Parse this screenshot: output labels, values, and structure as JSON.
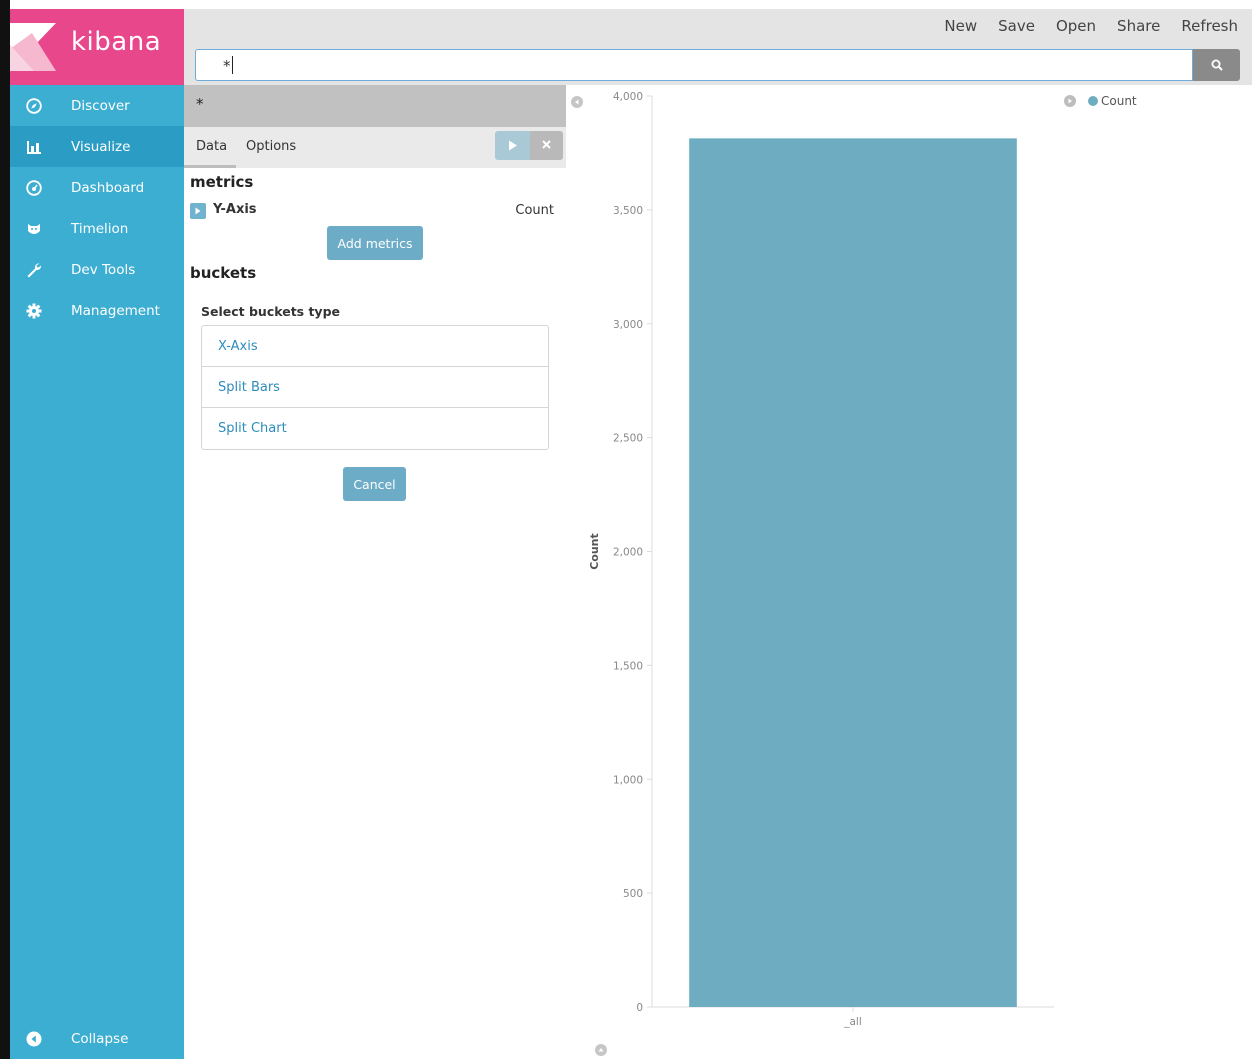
{
  "app": {
    "logo_text": "kibana",
    "brand_color": "#e8488b",
    "sidebar_color": "#3caed2"
  },
  "topnav": {
    "new": "New",
    "save": "Save",
    "open": "Open",
    "share": "Share",
    "refresh": "Refresh"
  },
  "search": {
    "query": "*"
  },
  "sidebar": {
    "items": [
      {
        "label": "Discover",
        "icon": "compass-icon"
      },
      {
        "label": "Visualize",
        "icon": "bar-chart-icon"
      },
      {
        "label": "Dashboard",
        "icon": "dashboard-icon"
      },
      {
        "label": "Timelion",
        "icon": "timelion-icon"
      },
      {
        "label": "Dev Tools",
        "icon": "wrench-icon"
      },
      {
        "label": "Management",
        "icon": "gear-icon"
      }
    ],
    "collapse_label": "Collapse"
  },
  "editor": {
    "index_pattern": "*",
    "tabs": {
      "data": "Data",
      "options": "Options"
    },
    "metrics_title": "metrics",
    "y_axis_label": "Y-Axis",
    "y_axis_value": "Count",
    "add_metrics": "Add metrics",
    "buckets_title": "buckets",
    "select_buckets_type": "Select buckets type",
    "bucket_options": [
      "X-Axis",
      "Split Bars",
      "Split Chart"
    ],
    "cancel": "Cancel"
  },
  "legend": {
    "label": "Count",
    "color": "#6eadc1"
  },
  "chart_data": {
    "type": "bar",
    "categories": [
      "_all"
    ],
    "series": [
      {
        "name": "Count",
        "values": [
          3814
        ]
      }
    ],
    "ylabel": "Count",
    "xlabel": "",
    "ylim": [
      0,
      4000
    ],
    "yticks": [
      "0",
      "500",
      "1,000",
      "1,500",
      "2,000",
      "2,500",
      "3,000",
      "3,500",
      "4,000"
    ],
    "bar_color": "#6eadc1",
    "legend_position": "top-right",
    "grid": false
  }
}
